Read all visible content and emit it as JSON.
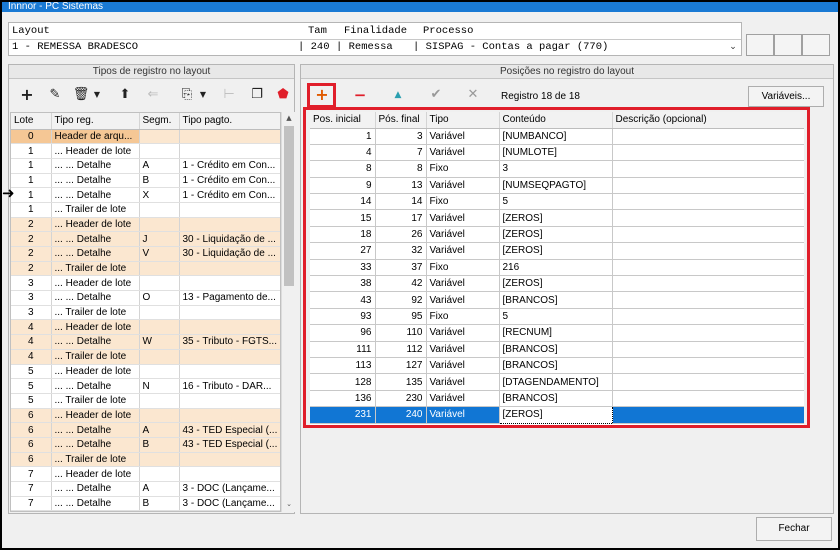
{
  "window": {
    "title": "Innnor - PC Sistemas"
  },
  "layout_header": {
    "col_layout": "Layout",
    "col_tam": "Tam",
    "col_finalidade": "Finalidade",
    "col_processo": "Processo",
    "layout_value": "1 - REMESSA BRADESCO",
    "tam_value": "| 240",
    "finalidade_value": "| Remessa",
    "processo_value": "| SISPAG - Contas a pagar (770)"
  },
  "left_panel": {
    "title": "Tipos de registro no layout",
    "columns": [
      "Lote",
      "Tipo reg.",
      "Segm.",
      "Tipo pagto."
    ],
    "rows": [
      {
        "lote": "0",
        "tipo": "Header de arqu...",
        "segm": "",
        "pagto": "",
        "orange": true,
        "first": true
      },
      {
        "lote": "1",
        "tipo": "... Header de lote",
        "segm": "",
        "pagto": "",
        "orange": false
      },
      {
        "lote": "1",
        "tipo": "... ... Detalhe",
        "segm": "A",
        "pagto": "1 - Crédito em Con...",
        "orange": false
      },
      {
        "lote": "1",
        "tipo": "... ... Detalhe",
        "segm": "B",
        "pagto": "1 - Crédito em Con...",
        "orange": false
      },
      {
        "lote": "1",
        "tipo": "... ... Detalhe",
        "segm": "X",
        "pagto": "1 - Crédito em Con...",
        "orange": false,
        "current": true
      },
      {
        "lote": "1",
        "tipo": "... Trailer de lote",
        "segm": "",
        "pagto": "",
        "orange": false
      },
      {
        "lote": "2",
        "tipo": "... Header de lote",
        "segm": "",
        "pagto": "",
        "orange": true
      },
      {
        "lote": "2",
        "tipo": "... ... Detalhe",
        "segm": "J",
        "pagto": "30 - Liquidação de ...",
        "orange": true
      },
      {
        "lote": "2",
        "tipo": "... ... Detalhe",
        "segm": "V",
        "pagto": "30 - Liquidação de ...",
        "orange": true
      },
      {
        "lote": "2",
        "tipo": "... Trailer de lote",
        "segm": "",
        "pagto": "",
        "orange": true
      },
      {
        "lote": "3",
        "tipo": "... Header de lote",
        "segm": "",
        "pagto": "",
        "orange": false
      },
      {
        "lote": "3",
        "tipo": "... ... Detalhe",
        "segm": "O",
        "pagto": "13 - Pagamento de...",
        "orange": false
      },
      {
        "lote": "3",
        "tipo": "... Trailer de lote",
        "segm": "",
        "pagto": "",
        "orange": false
      },
      {
        "lote": "4",
        "tipo": "... Header de lote",
        "segm": "",
        "pagto": "",
        "orange": true
      },
      {
        "lote": "4",
        "tipo": "... ... Detalhe",
        "segm": "W",
        "pagto": "35 - Tributo - FGTS...",
        "orange": true
      },
      {
        "lote": "4",
        "tipo": "... Trailer de lote",
        "segm": "",
        "pagto": "",
        "orange": true
      },
      {
        "lote": "5",
        "tipo": "... Header de lote",
        "segm": "",
        "pagto": "",
        "orange": false
      },
      {
        "lote": "5",
        "tipo": "... ... Detalhe",
        "segm": "N",
        "pagto": "16 - Tributo - DAR...",
        "orange": false
      },
      {
        "lote": "5",
        "tipo": "... Trailer de lote",
        "segm": "",
        "pagto": "",
        "orange": false
      },
      {
        "lote": "6",
        "tipo": "... Header de lote",
        "segm": "",
        "pagto": "",
        "orange": true
      },
      {
        "lote": "6",
        "tipo": "... ... Detalhe",
        "segm": "A",
        "pagto": "43 - TED Especial (...",
        "orange": true
      },
      {
        "lote": "6",
        "tipo": "... ... Detalhe",
        "segm": "B",
        "pagto": "43 - TED Especial (...",
        "orange": true
      },
      {
        "lote": "6",
        "tipo": "... Trailer de lote",
        "segm": "",
        "pagto": "",
        "orange": true
      },
      {
        "lote": "7",
        "tipo": "... Header de lote",
        "segm": "",
        "pagto": "",
        "orange": false
      },
      {
        "lote": "7",
        "tipo": "... ... Detalhe",
        "segm": "A",
        "pagto": "3 - DOC (Lançame...",
        "orange": false
      },
      {
        "lote": "7",
        "tipo": "... ... Detalhe",
        "segm": "B",
        "pagto": "3 - DOC (Lançame...",
        "orange": false
      }
    ]
  },
  "right_panel": {
    "title": "Posições no registro do layout",
    "registro_label": "Registro 18 de 18",
    "variaveis_label": "Variáveis...",
    "columns": [
      "Pos. inicial",
      "Pós. final",
      "Tipo",
      "Conteúdo",
      "Descrição (opcional)"
    ],
    "rows": [
      {
        "ini": "1",
        "fim": "3",
        "tipo": "Variável",
        "conteudo": "[NUMBANCO]",
        "desc": ""
      },
      {
        "ini": "4",
        "fim": "7",
        "tipo": "Variável",
        "conteudo": "[NUMLOTE]",
        "desc": ""
      },
      {
        "ini": "8",
        "fim": "8",
        "tipo": "Fixo",
        "conteudo": "3",
        "desc": ""
      },
      {
        "ini": "9",
        "fim": "13",
        "tipo": "Variável",
        "conteudo": "[NUMSEQPAGTO]",
        "desc": ""
      },
      {
        "ini": "14",
        "fim": "14",
        "tipo": "Fixo",
        "conteudo": "5",
        "desc": ""
      },
      {
        "ini": "15",
        "fim": "17",
        "tipo": "Variável",
        "conteudo": "[ZEROS]",
        "desc": ""
      },
      {
        "ini": "18",
        "fim": "26",
        "tipo": "Variável",
        "conteudo": "[ZEROS]",
        "desc": ""
      },
      {
        "ini": "27",
        "fim": "32",
        "tipo": "Variável",
        "conteudo": "[ZEROS]",
        "desc": ""
      },
      {
        "ini": "33",
        "fim": "37",
        "tipo": "Fixo",
        "conteudo": "216",
        "desc": ""
      },
      {
        "ini": "38",
        "fim": "42",
        "tipo": "Variável",
        "conteudo": "[ZEROS]",
        "desc": ""
      },
      {
        "ini": "43",
        "fim": "92",
        "tipo": "Variável",
        "conteudo": "[BRANCOS]",
        "desc": ""
      },
      {
        "ini": "93",
        "fim": "95",
        "tipo": "Fixo",
        "conteudo": "5",
        "desc": ""
      },
      {
        "ini": "96",
        "fim": "110",
        "tipo": "Variável",
        "conteudo": "[RECNUM]",
        "desc": ""
      },
      {
        "ini": "111",
        "fim": "112",
        "tipo": "Variável",
        "conteudo": "[BRANCOS]",
        "desc": ""
      },
      {
        "ini": "113",
        "fim": "127",
        "tipo": "Variável",
        "conteudo": "[BRANCOS]",
        "desc": ""
      },
      {
        "ini": "128",
        "fim": "135",
        "tipo": "Variável",
        "conteudo": "[DTAGENDAMENTO]",
        "desc": ""
      },
      {
        "ini": "136",
        "fim": "230",
        "tipo": "Variável",
        "conteudo": "[BRANCOS]",
        "desc": ""
      },
      {
        "ini": "231",
        "fim": "240",
        "tipo": "Variável",
        "conteudo": "[ZEROS]",
        "desc": "",
        "selected": true
      }
    ]
  },
  "footer": {
    "fechar_label": "Fechar"
  },
  "colors": {
    "highlight_red": "#e01e2a",
    "selection_blue": "#1176d4",
    "orange_row": "#fbe7d0",
    "header_first": "#f5c795"
  }
}
